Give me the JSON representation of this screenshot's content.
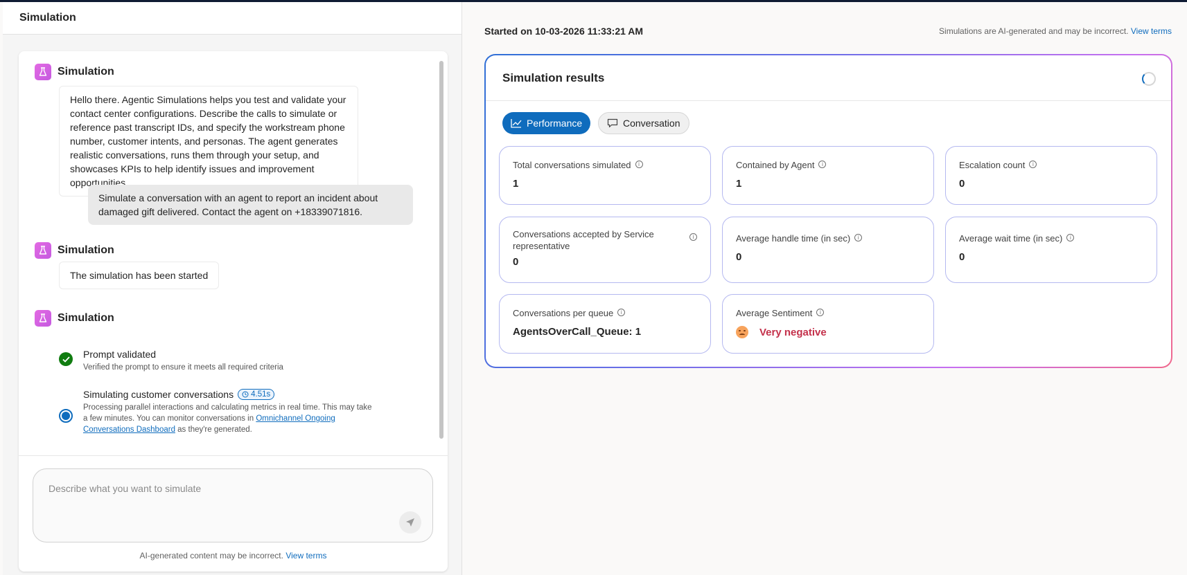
{
  "left": {
    "header_title": "Simulation",
    "sim_label": "Simulation",
    "welcome": "Hello there. Agentic Simulations helps you test and validate your contact center configurations. Describe the calls to simulate or reference past transcript IDs, and specify the workstream phone number, customer intents, and personas. The agent generates realistic conversations, runs them through your setup, and showcases KPIs to help identify issues and improvement opportunities.",
    "user_message": "Simulate a conversation with an agent to report an incident about damaged gift delivered. Contact the agent on +18339071816.",
    "started_msg": "The simulation has been started",
    "steps": [
      {
        "title": "Prompt validated",
        "desc": "Verified the prompt to ensure it meets all required criteria"
      },
      {
        "title": "Simulating customer conversations",
        "badge": "4.51s",
        "desc_before": "Processing parallel interactions and calculating metrics in real time. This may take a few minutes. You can monitor conversations in ",
        "desc_link": "Omnichannel Ongoing Conversations Dashboard",
        "desc_after": " as they're generated."
      }
    ],
    "input_placeholder": "Describe what you want to simulate",
    "disclaimer": "AI-generated content may be incorrect.",
    "view_terms": "View terms"
  },
  "right": {
    "started": "Started on 10-03-2026 11:33:21 AM",
    "disclaimer": "Simulations are AI-generated and may be incorrect.",
    "view_terms": "View terms",
    "results_title": "Simulation results",
    "tabs": [
      "Performance",
      "Conversation"
    ],
    "metrics": [
      {
        "label": "Total conversations simulated",
        "value": "1"
      },
      {
        "label": "Contained by Agent",
        "value": "1"
      },
      {
        "label": "Escalation count",
        "value": "0"
      },
      {
        "label": "Conversations accepted by Service representative",
        "value": "0"
      },
      {
        "label": "Average handle time (in sec)",
        "value": "0"
      },
      {
        "label": "Average wait time (in sec)",
        "value": "0"
      },
      {
        "label": "Conversations per queue",
        "value": "AgentsOverCall_Queue: 1"
      },
      {
        "label": "Average Sentiment",
        "value": "Very negative"
      }
    ]
  },
  "colors": {
    "accent": "#0f6cbd",
    "success": "#107c10",
    "negative": "#c4314b"
  }
}
